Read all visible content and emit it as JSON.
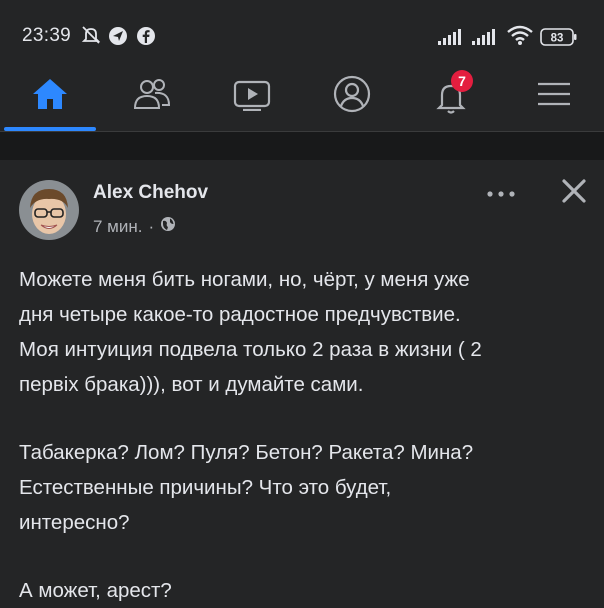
{
  "status_bar": {
    "time": "23:39",
    "battery": "83",
    "icons": [
      "mute-icon",
      "send-icon",
      "facebook-icon",
      "signal-icon",
      "signal-icon-2",
      "wifi-icon",
      "battery-icon"
    ]
  },
  "nav": {
    "items": [
      {
        "name": "home",
        "icon": "home-icon",
        "active": true
      },
      {
        "name": "friends",
        "icon": "friends-icon"
      },
      {
        "name": "watch",
        "icon": "video-icon"
      },
      {
        "name": "profile",
        "icon": "profile-icon"
      },
      {
        "name": "notifications",
        "icon": "bell-icon",
        "badge": "7"
      },
      {
        "name": "menu",
        "icon": "menu-icon"
      }
    ],
    "accent": "#2d88ff",
    "badge_color": "#e41e3f"
  },
  "post": {
    "author": "Alex Chehov",
    "time": "7 мин.",
    "separator": "·",
    "paragraphs": [
      "Можете меня бить ногами, но, чёрт, у меня уже\nдня четыре какое-то радостное предчувствие.\nМоя интуиция подвела только 2 раза в жизни ( 2\nпервіх брака))), вот и думайте сами.",
      "Табакерка? Лом? Пуля? Бетон? Ракета? Мина?\nЕстественные причины? Что это будет,\nинтересно?",
      "А может, арест?"
    ]
  }
}
